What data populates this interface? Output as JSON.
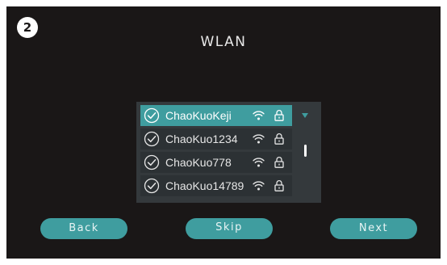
{
  "step_number": "2",
  "screen_title": "WLAN",
  "colors": {
    "accent": "#3f9d9f",
    "background": "#1a1717",
    "panel": "#34393c",
    "row": "#2c3134"
  },
  "wifi_list": {
    "dropdown_icon": "triangle-down-icon",
    "scrollbar": "vertical-scroll-thumb",
    "networks": [
      {
        "ssid": "ChaoKuoKeji",
        "selected": true,
        "icons": [
          "check-circle-icon",
          "wifi-signal-icon",
          "lock-icon"
        ]
      },
      {
        "ssid": "ChaoKuo1234",
        "selected": false,
        "icons": [
          "check-circle-icon",
          "wifi-signal-icon",
          "lock-icon"
        ]
      },
      {
        "ssid": "ChaoKuo778",
        "selected": false,
        "icons": [
          "check-circle-icon",
          "wifi-signal-icon",
          "lock-icon"
        ]
      },
      {
        "ssid": "ChaoKuo14789",
        "selected": false,
        "icons": [
          "check-circle-icon",
          "wifi-signal-icon",
          "lock-icon"
        ]
      }
    ]
  },
  "buttons": {
    "back": "Back",
    "skip": "Skip",
    "next": "Next"
  }
}
